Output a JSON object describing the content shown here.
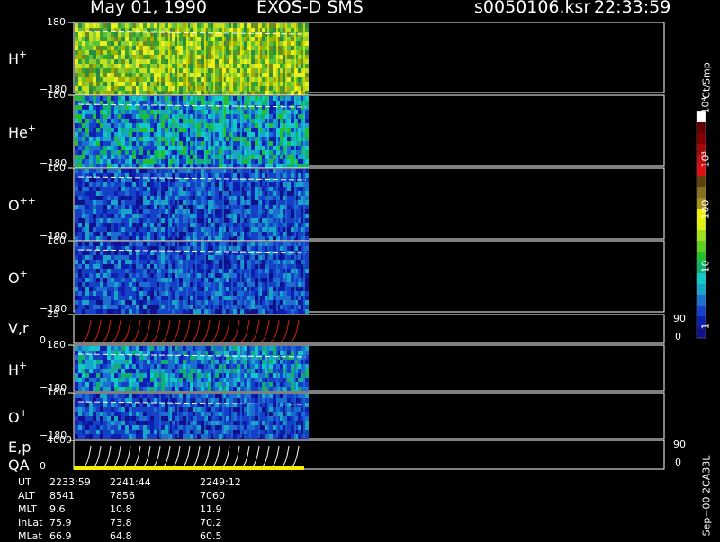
{
  "header": {
    "date": "May 01, 1990",
    "instrument": "EXOS-D SMS",
    "file": "s0050106.ksr",
    "time": "22:33:59"
  },
  "chart_data": {
    "type": "heatmap",
    "title": "May 01, 1990   EXOS-D SMS",
    "panels": [
      {
        "id": "H+",
        "label": "H",
        "sup": "+",
        "ytop": "180",
        "ybot": "−180",
        "kind": "spectrogram",
        "color": "#4fbf3a"
      },
      {
        "id": "He+",
        "label": "He",
        "sup": "+",
        "ytop": "180",
        "ybot": "−180",
        "kind": "spectrogram",
        "color": "#1d6fbf"
      },
      {
        "id": "O++",
        "label": "O",
        "sup": "++",
        "ytop": "180",
        "ybot": "−180",
        "kind": "spectrogram",
        "color": "#0e3aa0"
      },
      {
        "id": "O+",
        "label": "O",
        "sup": "+",
        "ytop": "180",
        "ybot": "−180",
        "kind": "spectrogram",
        "color": "#1a50b0"
      },
      {
        "id": "Vr",
        "label": "V,r",
        "sup": "",
        "ytop": "25",
        "ybot": "0",
        "right_top": "90",
        "right_bot": "0",
        "kind": "line",
        "color": "#d02010"
      },
      {
        "id": "H+b",
        "label": "H",
        "sup": "+",
        "ytop": "180",
        "ybot": "−180",
        "kind": "spectrogram",
        "color": "#1d6fbf"
      },
      {
        "id": "O+b",
        "label": "O",
        "sup": "+",
        "ytop": "180",
        "ybot": "−180",
        "kind": "spectrogram",
        "color": "#0e3aa0"
      },
      {
        "id": "Ep",
        "label": "E,p",
        "sup": "",
        "label2": "QA",
        "ytop": "4000",
        "ybot": "0",
        "right_top": "90",
        "right_bot": "0",
        "kind": "line",
        "color": "#ffffff"
      }
    ],
    "colorbar": {
      "unit": "Ct/Smp",
      "ticks": [
        "1",
        "10",
        "100",
        "10³",
        "10⁴"
      ],
      "colors": [
        "#10108a",
        "#0d1fb0",
        "#1540c8",
        "#1c6fd0",
        "#18a6c8",
        "#12c8c8",
        "#10b070",
        "#22c030",
        "#60d020",
        "#a0e020",
        "#e0f010",
        "#f0f000",
        "#a89020",
        "#807020",
        "#604010",
        "#e01010",
        "#c01010",
        "#a00808",
        "#800000",
        "#600000",
        "#ffffff"
      ]
    },
    "ut_table": {
      "rows": [
        {
          "name": "UT",
          "values": [
            "2233:59",
            "2241:44",
            "2249:12"
          ]
        },
        {
          "name": "ALT",
          "values": [
            "8541",
            "7856",
            "7060"
          ]
        },
        {
          "name": "MLT",
          "values": [
            "9.6",
            "10.8",
            "11.9"
          ]
        },
        {
          "name": "InLat",
          "values": [
            "75.9",
            "73.8",
            "70.2"
          ]
        },
        {
          "name": "MLat",
          "values": [
            "66.9",
            "64.8",
            "60.5"
          ]
        }
      ]
    },
    "plot_code": "Sep−00  2CA33L"
  }
}
